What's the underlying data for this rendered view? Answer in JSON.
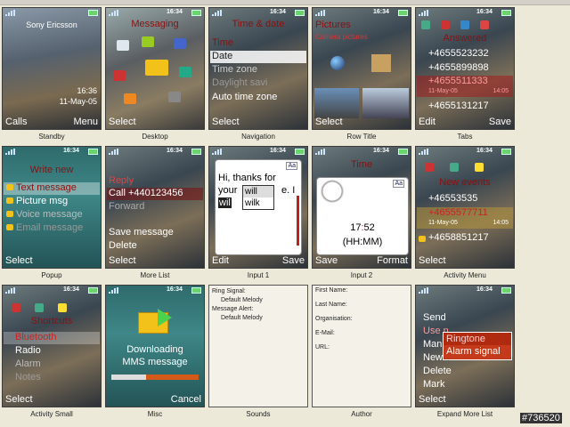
{
  "watermark": "#736520",
  "colors": {
    "accent_red": "#8b1010",
    "bg": "#ece9d8",
    "selection": "#a01e1e"
  },
  "cells": [
    {
      "caption": "Standby",
      "time": "",
      "title": "Sony Ericsson",
      "clock": "16:36",
      "date": "11-May-05",
      "left_soft": "Calls",
      "right_soft": "Menu"
    },
    {
      "caption": "Desktop",
      "time": "16:34",
      "title": "Messaging",
      "left_soft": "Select"
    },
    {
      "caption": "Navigation",
      "time": "16:34",
      "title": "Time & date",
      "items": [
        "Time",
        "Date",
        "Time zone",
        "Daylight savi",
        "Auto time zone"
      ],
      "left_soft": "Select"
    },
    {
      "caption": "Row Title",
      "time": "16:34",
      "title": "Pictures",
      "subtitle": "Camera pictures",
      "left_soft": "Select"
    },
    {
      "caption": "Tabs",
      "time": "16:34",
      "title": "Answered",
      "items": [
        "+4655523232",
        "+4655899898",
        "+4655511333",
        "+4655131217"
      ],
      "item_date": "11-May-05",
      "item_time": "14:05",
      "left_soft": "Edit",
      "right_soft": "Save"
    },
    {
      "caption": "Popup",
      "time": "16:34",
      "title": "Write new",
      "items": [
        "Text message",
        "Picture msg",
        "Voice message",
        "Email message"
      ],
      "left_soft": "Select"
    },
    {
      "caption": "More List",
      "time": "16:34",
      "items": [
        "Reply",
        "Call +440123456",
        "Forward",
        "Save message",
        "Delete"
      ],
      "left_soft": "Select"
    },
    {
      "caption": "Input 1",
      "time": "16:34",
      "mode": "Aa",
      "text_line1": "Hi, thanks for",
      "text_line2a": "your ",
      "text_line2b": "e. I",
      "text_typed": "wil",
      "suggestions": [
        "will",
        "wilk"
      ],
      "left_soft": "Edit",
      "right_soft": "Save"
    },
    {
      "caption": "Input 2",
      "time": "16:34",
      "title": "Time",
      "mode": "Aa",
      "clock_hh": "17",
      "clock_sep": ":",
      "clock_mm": "52",
      "clock_fmt": "(HH:MM)",
      "left_soft": "Save",
      "right_soft": "Format"
    },
    {
      "caption": "Activity Menu",
      "time": "16:34",
      "title": "New events",
      "items": [
        "+46553535",
        "+4655577711",
        "+4658851217"
      ],
      "item_date": "11-May-05",
      "item_time": "14:05",
      "left_soft": "Select"
    },
    {
      "caption": "Activity Small",
      "time": "16:34",
      "title": "Shortcuts",
      "items": [
        "Bluetooth",
        "Radio",
        "Alarm",
        "Notes"
      ],
      "left_soft": "Select"
    },
    {
      "caption": "Misc",
      "time": "16:34",
      "line1": "Downloading",
      "line2": "MMS message",
      "right_soft": "Cancel"
    },
    {
      "caption": "Sounds",
      "lines": [
        "Ring Signal:",
        "Default Melody",
        "Message Alert:",
        "Default Melody"
      ]
    },
    {
      "caption": "Author",
      "lines": [
        "First Name:",
        "Last Name:",
        "Organisation:",
        "E-Mail:",
        "URL:"
      ]
    },
    {
      "caption": "Expand More List",
      "time": "16:34",
      "items": [
        "Send",
        "Use n",
        "Man",
        "New",
        "Delete",
        "Mark"
      ],
      "popup": [
        "Ringtone",
        "Alarm signal"
      ],
      "left_soft": "Select"
    }
  ]
}
